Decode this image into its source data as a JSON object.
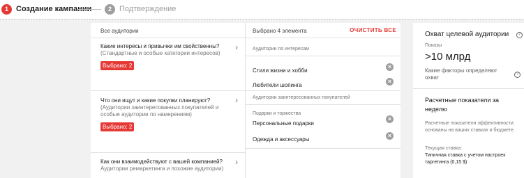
{
  "stepper": {
    "step1": {
      "number": "1",
      "label": "Создание кампании"
    },
    "step2": {
      "number": "2",
      "label": "Подтверждение"
    }
  },
  "audiences": {
    "header": "Все аудитории",
    "categories": [
      {
        "title": "Какие интересы и привычки им свойственны?",
        "subtitle": "(Стандартные и особые категории интересов)",
        "badge": "Выбрано: 2"
      },
      {
        "title": "Что они ищут и какие покупки планируют?",
        "subtitle": "(Аудитории заинтересованных покупателей и особые аудитории по намерениям)",
        "badge": "Выбрано: 2"
      },
      {
        "title": "Как они взаимодействуют с вашей компанией?",
        "subtitle": "Аудитории ремаркетинга и похожие аудитории)"
      }
    ]
  },
  "selected": {
    "count_label": "Выбрано 4 элемента",
    "clear_label": "ОЧИСТИТЬ ВСЕ",
    "groups": [
      {
        "header": "Аудитории по интересам",
        "items": [
          {
            "label": "Стили жизни и хобби"
          },
          {
            "label": "Любители шопинга"
          }
        ]
      },
      {
        "header": "Аудитории заинтересованных покупателей",
        "items": [
          {
            "parent": "Подарки и торжества",
            "label": "Персональные подарки"
          },
          {
            "label": "Одежда и аксессуары"
          }
        ]
      }
    ]
  },
  "reach": {
    "title": "Охват целевой аудитории",
    "impressions_label": "Показы",
    "impressions_value": ">10 млрд",
    "factors_text": "Какие факторы определяют охват",
    "estimates_title": "Расчетные показатели за неделю",
    "estimates_note": "Расчетные показатели эффективности основаны на ваших ставках и бюджете.",
    "bid_label": "Текущая ставка:",
    "bid_value": "Типичная ставка с учетом настроек таргетинга (0,15 $)"
  },
  "colors": {
    "accent": "#e53935",
    "muted": "#9e9e9e"
  }
}
